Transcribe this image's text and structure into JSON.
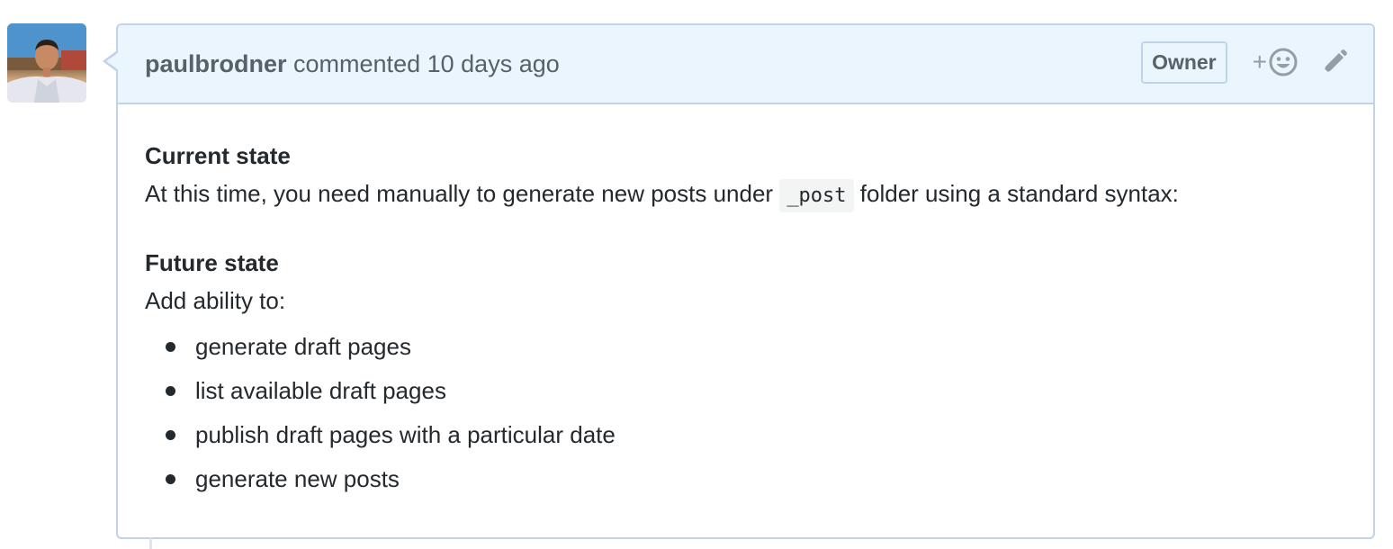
{
  "comment": {
    "author": "paulbrodner",
    "action": "commented",
    "time": "10 days ago",
    "badge": "Owner"
  },
  "body": {
    "current_title": "Current state",
    "current_pre": "At this time, you need manually to generate new posts under",
    "current_code": "_post",
    "current_post": "folder using a standard syntax:",
    "future_title": "Future state",
    "future_intro": "Add ability to:",
    "items": [
      "generate draft pages",
      "list available draft pages",
      "publish draft pages with a particular date",
      "generate new posts"
    ]
  },
  "icons": {
    "avatar": "user-avatar",
    "reaction": "add-reaction-smiley-icon",
    "edit": "pencil-icon"
  },
  "colors": {
    "header_bg": "#eaf5fd",
    "border": "#c0d3eb",
    "muted_text": "#586069",
    "icon_gray": "#959da5"
  }
}
